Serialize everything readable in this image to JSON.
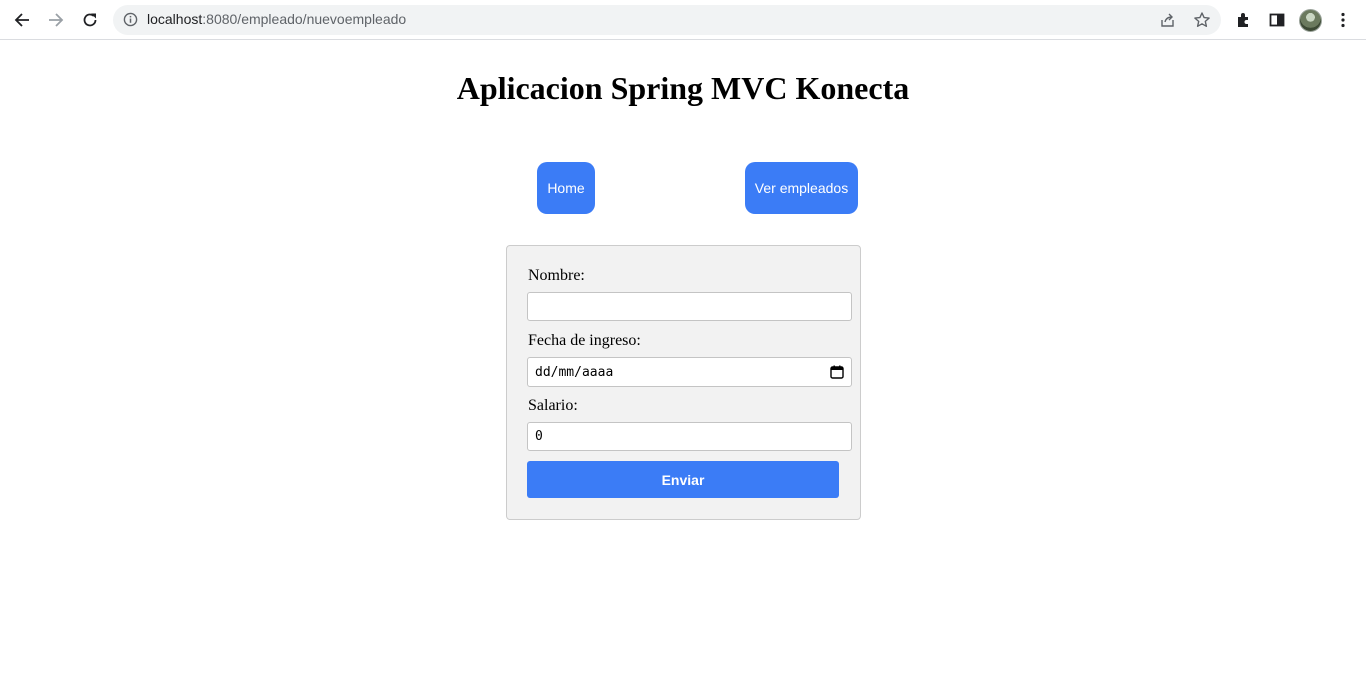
{
  "browser": {
    "url_host": "localhost",
    "url_rest": ":8080/empleado/nuevoempleado"
  },
  "page": {
    "title": "Aplicacion Spring MVC Konecta"
  },
  "nav": {
    "home_label": "Home",
    "ver_empleados_label": "Ver empleados"
  },
  "form": {
    "nombre_label": "Nombre:",
    "nombre_value": "",
    "fecha_label": "Fecha de ingreso:",
    "fecha_placeholder": "dd/mm/aaaa",
    "salario_label": "Salario:",
    "salario_value": "0",
    "submit_label": "Enviar"
  },
  "colors": {
    "accent": "#3b7cf6",
    "form_background": "#f2f2f2"
  }
}
